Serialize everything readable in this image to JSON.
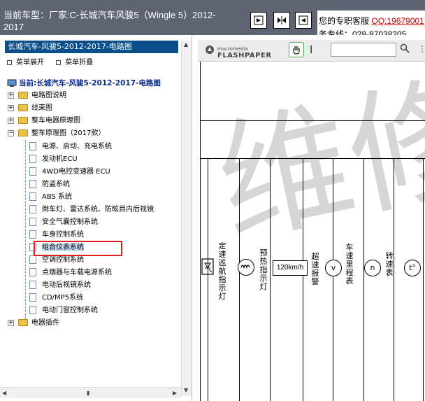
{
  "header": {
    "title": "当前车型：厂家:C-长城汽车风骏5（Wingle 5）2012-2017",
    "support_line1_prefix": "您的专职客服",
    "support_qq": "QQ:19679001",
    "support_line2": "务专线：028-87038205"
  },
  "tree_panel": {
    "title": "长城汽车-风骏5-2012-2017-电路图",
    "expand_label": "菜单展开",
    "collapse_label": "菜单折叠",
    "root_label": "当前:长城汽车-风骏5-2012-2017-电路图",
    "items": [
      {
        "label": "电路图说明"
      },
      {
        "label": "线束图"
      },
      {
        "label": "整车电器原理图"
      },
      {
        "label": "整车原理图（2017款）"
      }
    ],
    "sub_items": [
      {
        "label": "电源、启动、充电系统"
      },
      {
        "label": "发动机ECU"
      },
      {
        "label": "4WD电控变速器 ECU"
      },
      {
        "label": "防盗系统"
      },
      {
        "label": "ABS 系统"
      },
      {
        "label": "倒车灯、雷达系统、防眩目内后视镜"
      },
      {
        "label": "安全气囊控制系统"
      },
      {
        "label": "车身控制系统"
      },
      {
        "label": "组合仪表系统"
      },
      {
        "label": "空调控制系统"
      },
      {
        "label": "点烟器与车载电源系统"
      },
      {
        "label": "电动后视镜系统"
      },
      {
        "label": "CD/MP5系统"
      },
      {
        "label": "电动门窗控制系统"
      }
    ],
    "last_item": {
      "label": "电器插件"
    },
    "selected_index": 8
  },
  "viewer": {
    "brand_small": "macromedia",
    "brand_name": "FLASHPAPER",
    "diagram_labels": {
      "cruise": "定速巡航指示灯",
      "preheat": "预热指示灯",
      "speed_box": "120km/h",
      "overspeed": "超速报警",
      "odometer": "车速里程表",
      "v_symbol": "v",
      "n_symbol": "n",
      "tach": "转速表",
      "t_symbol": "t°"
    },
    "watermark": "维修"
  }
}
